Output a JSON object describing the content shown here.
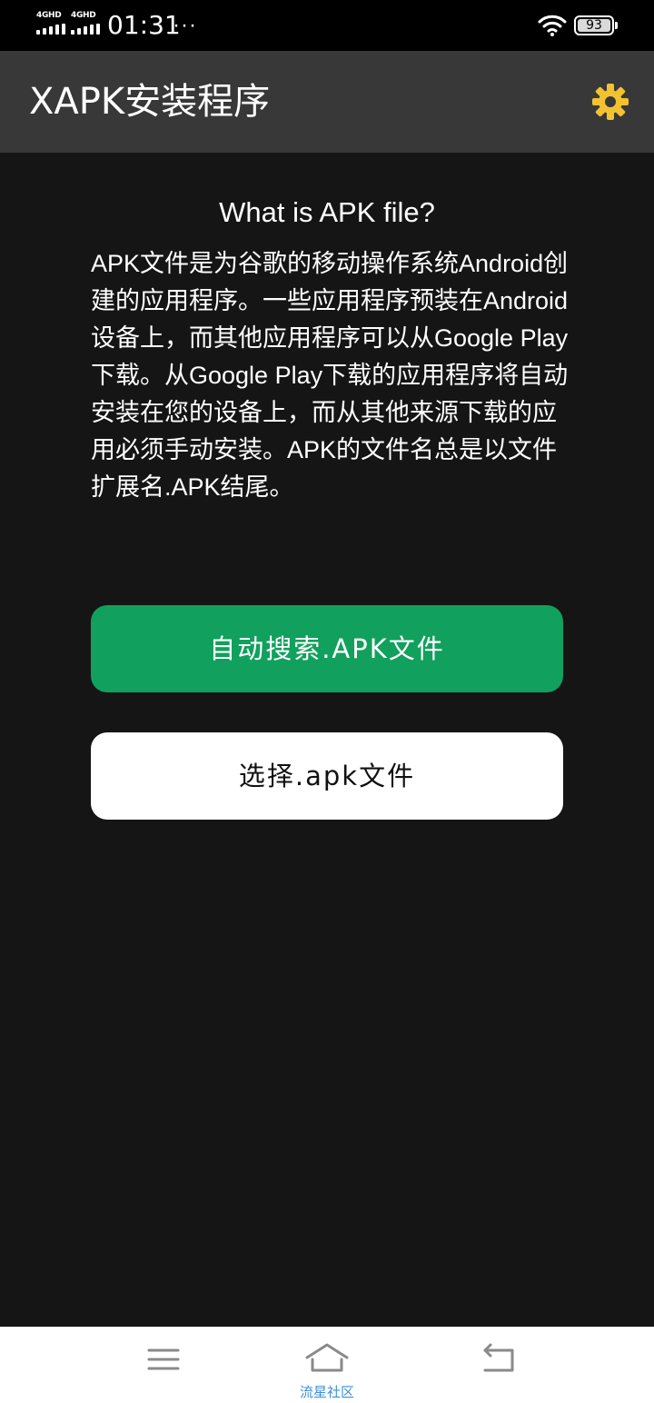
{
  "status_bar": {
    "network_1": "4GHD",
    "network_2": "4GHD",
    "time": "01:31",
    "more": "···",
    "battery": "93",
    "icons": [
      "signal-icon",
      "signal-icon",
      "wifi-icon",
      "battery-icon"
    ]
  },
  "app_bar": {
    "title": "XAPK安装程序",
    "settings_icon": "gear-icon",
    "accent_color": "#f2c230"
  },
  "main": {
    "heading": "What is APK file?",
    "description": "APK文件是为谷歌的移动操作系统Android创建的应用程序。一些应用程序预装在Android设备上，而其他应用程序可以从Google Play下载。从Google Play下载的应用程序将自动安装在您的设备上，而从其他来源下载的应用必须手动安装。APK的文件名总是以文件扩展名.APK结尾。",
    "auto_search_button": "自动搜索.APK文件",
    "select_file_button": "选择.apk文件",
    "colors": {
      "primary_button": "#11a05d",
      "secondary_button": "#ffffff",
      "background": "#151515",
      "app_bar": "#383838"
    }
  },
  "nav_bar": {
    "icons": [
      "menu-icon",
      "home-icon",
      "back-icon"
    ],
    "watermark": "流星社区"
  }
}
